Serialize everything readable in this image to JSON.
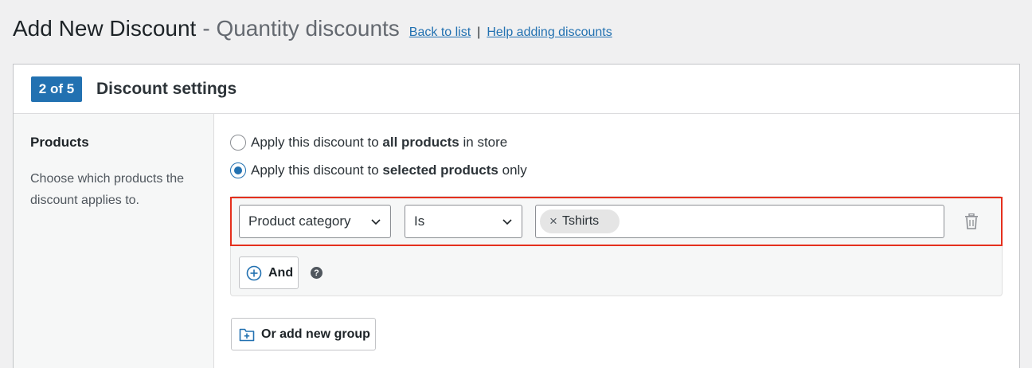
{
  "header": {
    "title": "Add New Discount",
    "subtitle": "- Quantity discounts",
    "back_link": "Back to list",
    "separator": "|",
    "help_link": "Help adding discounts"
  },
  "card": {
    "step_badge": "2 of 5",
    "section_title": "Discount settings"
  },
  "sidebar": {
    "title": "Products",
    "description": "Choose which products the discount applies to."
  },
  "options": [
    {
      "prefix": "Apply this discount to ",
      "bold": "all products",
      "suffix": " in store",
      "checked": false
    },
    {
      "prefix": "Apply this discount to ",
      "bold": "selected products",
      "suffix": " only",
      "checked": true
    }
  ],
  "condition": {
    "field": "Product category",
    "operator": "Is",
    "values": [
      "Tshirts"
    ],
    "remove_chip_glyph": "×"
  },
  "and_button": "And",
  "help_glyph": "?",
  "add_group_button": "Or add new group",
  "colors": {
    "accent": "#2271b1",
    "highlight_border": "#e5301d"
  }
}
